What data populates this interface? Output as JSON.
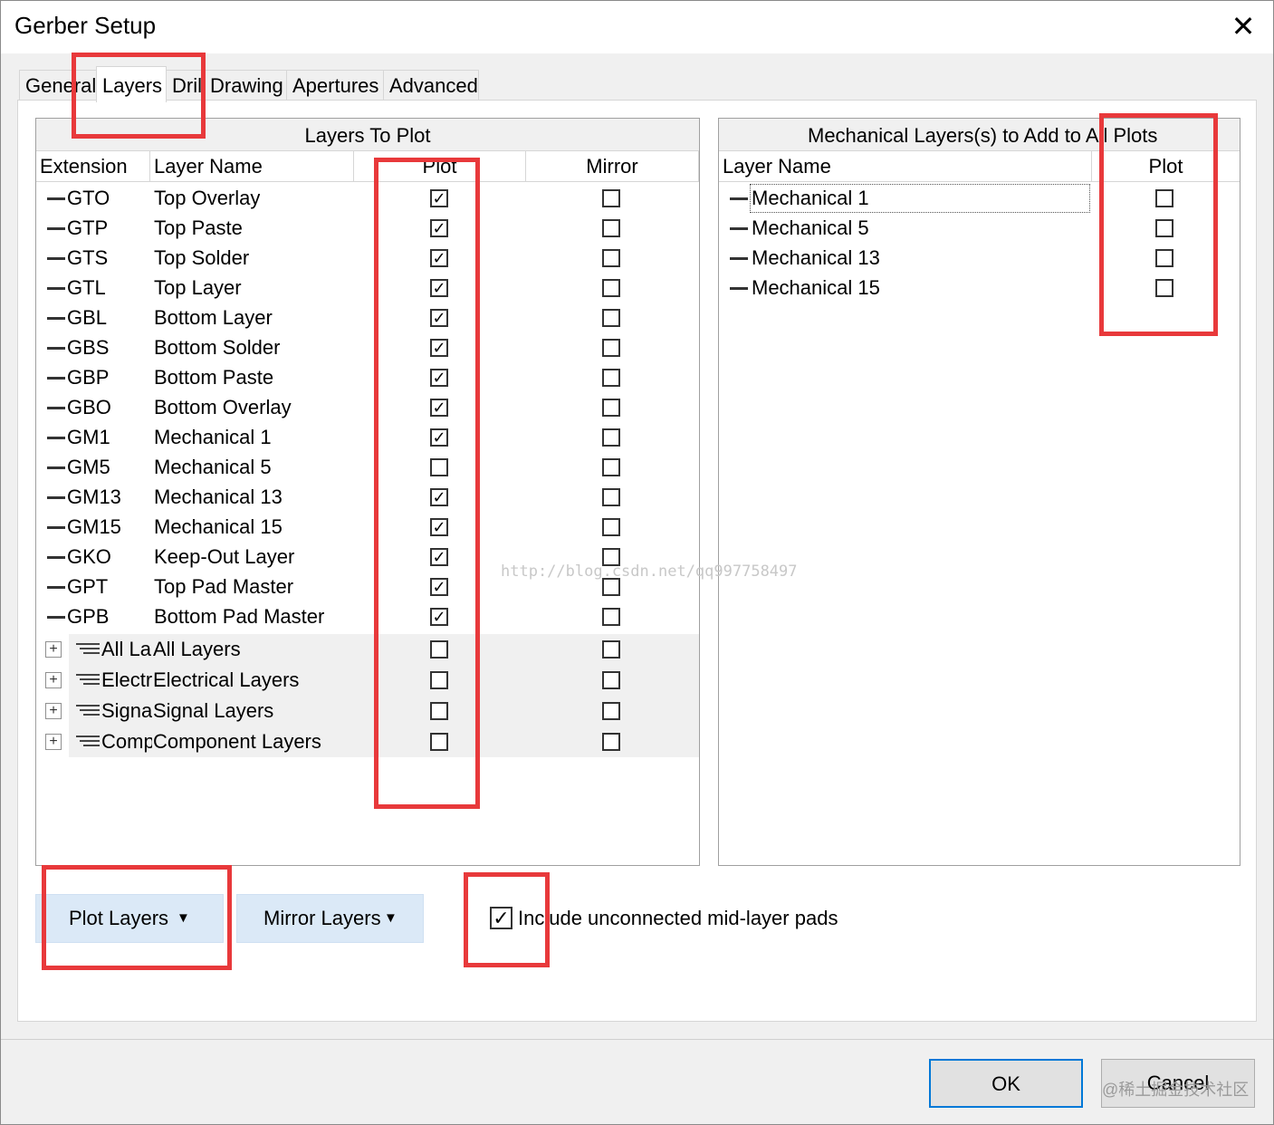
{
  "window": {
    "title": "Gerber Setup",
    "close_glyph": "✕"
  },
  "tabs": [
    {
      "label": "General",
      "active": false
    },
    {
      "label": "Layers",
      "active": true
    },
    {
      "label": "Drill",
      "active": false
    },
    {
      "label": "Drawing",
      "active": false
    },
    {
      "label": "Apertures",
      "active": false
    },
    {
      "label": "Advanced",
      "active": false
    }
  ],
  "layers_panel": {
    "title": "Layers To Plot",
    "columns": {
      "extension": "Extension",
      "layer_name": "Layer Name",
      "plot": "Plot",
      "mirror": "Mirror"
    },
    "rows": [
      {
        "ext": "GTO",
        "name": "Top Overlay",
        "plot": true,
        "mirror": false
      },
      {
        "ext": "GTP",
        "name": "Top Paste",
        "plot": true,
        "mirror": false
      },
      {
        "ext": "GTS",
        "name": "Top Solder",
        "plot": true,
        "mirror": false
      },
      {
        "ext": "GTL",
        "name": "Top Layer",
        "plot": true,
        "mirror": false
      },
      {
        "ext": "GBL",
        "name": "Bottom Layer",
        "plot": true,
        "mirror": false
      },
      {
        "ext": "GBS",
        "name": "Bottom Solder",
        "plot": true,
        "mirror": false
      },
      {
        "ext": "GBP",
        "name": "Bottom Paste",
        "plot": true,
        "mirror": false
      },
      {
        "ext": "GBO",
        "name": "Bottom Overlay",
        "plot": true,
        "mirror": false
      },
      {
        "ext": "GM1",
        "name": "Mechanical 1",
        "plot": true,
        "mirror": false
      },
      {
        "ext": "GM5",
        "name": "Mechanical 5",
        "plot": false,
        "mirror": false
      },
      {
        "ext": "GM13",
        "name": "Mechanical 13",
        "plot": true,
        "mirror": false
      },
      {
        "ext": "GM15",
        "name": "Mechanical 15",
        "plot": true,
        "mirror": false
      },
      {
        "ext": "GKO",
        "name": "Keep-Out Layer",
        "plot": true,
        "mirror": false
      },
      {
        "ext": "GPT",
        "name": "Top Pad Master",
        "plot": true,
        "mirror": false
      },
      {
        "ext": "GPB",
        "name": "Bottom Pad Master",
        "plot": true,
        "mirror": false
      }
    ],
    "groups": [
      {
        "ext": "All La",
        "name": "All Layers",
        "plot": false,
        "mirror": false
      },
      {
        "ext": "Electr",
        "name": "Electrical Layers",
        "plot": false,
        "mirror": false
      },
      {
        "ext": "Signa",
        "name": "Signal Layers",
        "plot": false,
        "mirror": false
      },
      {
        "ext": "Comp",
        "name": "Component Layers",
        "plot": false,
        "mirror": false
      }
    ]
  },
  "mech_panel": {
    "title": "Mechanical Layers(s) to Add to All Plots",
    "columns": {
      "layer_name": "Layer Name",
      "plot": "Plot"
    },
    "rows": [
      {
        "name": "Mechanical 1",
        "plot": false
      },
      {
        "name": "Mechanical 5",
        "plot": false
      },
      {
        "name": "Mechanical 13",
        "plot": false
      },
      {
        "name": "Mechanical 15",
        "plot": false
      }
    ]
  },
  "buttons": {
    "plot_layers": "Plot Layers",
    "mirror_layers": "Mirror Layers",
    "dropdown_glyph": "▼",
    "ok": "OK",
    "cancel": "Cancel"
  },
  "options": {
    "include_unconnected_label": "Include unconnected mid-layer pads",
    "include_unconnected_checked": true
  },
  "check_glyph": "✓",
  "expand_glyph": "+",
  "watermarks": {
    "url": "http://blog.csdn.net/qq997758497",
    "community": "@稀土掘金技术社区"
  },
  "colors": {
    "highlight": "#e8393b",
    "button_blue": "#dbe9f7"
  }
}
